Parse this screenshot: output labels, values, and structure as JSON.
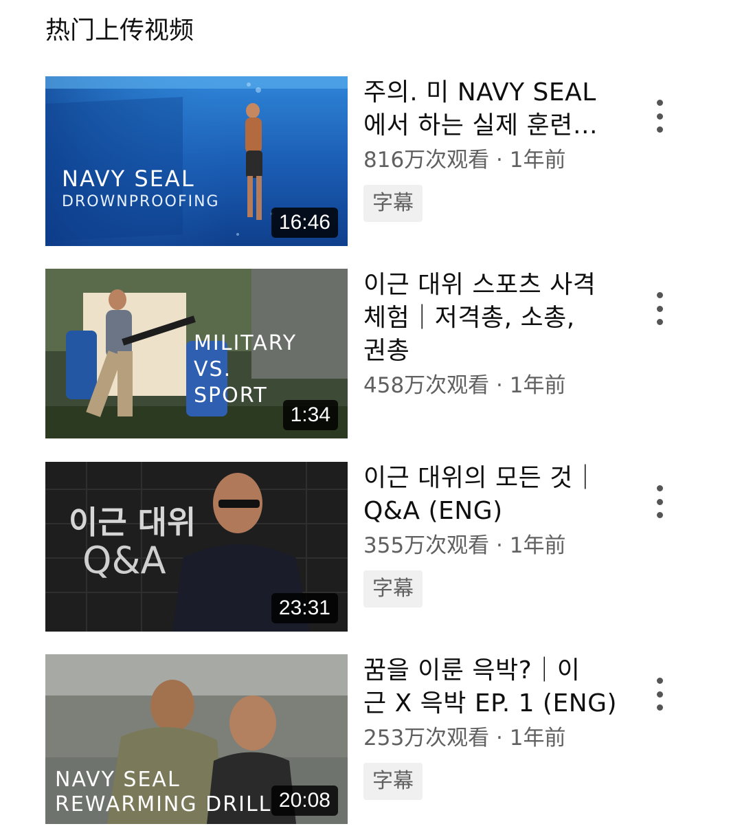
{
  "section": {
    "title": "热门上传视频"
  },
  "videos": [
    {
      "title_line1": "주의. 미 NAVY SEAL",
      "title_line2": "에서 하는 실제 훈련…",
      "title_line3": "",
      "stats": "816万次观看 · 1年前",
      "badge": "字幕",
      "duration": "16:46",
      "thumb_text": [
        "NAVY SEAL",
        "DROWNPROOFING"
      ]
    },
    {
      "title_line1": "이근 대위 스포츠 사격",
      "title_line2": "체험｜저격총, 소총,",
      "title_line3": "권총",
      "stats": "458万次观看 · 1年前",
      "badge": "",
      "duration": "1:34",
      "thumb_text": [
        "MILITARY",
        "VS.",
        "SPORT"
      ]
    },
    {
      "title_line1": "이근 대위의 모든 것｜",
      "title_line2": "Q&A (ENG)",
      "title_line3": "",
      "stats": "355万次观看 · 1年前",
      "badge": "字幕",
      "duration": "23:31",
      "thumb_text": [
        "이근 대위",
        "Q&A"
      ]
    },
    {
      "title_line1": "꿈을 이룬 윽박?｜이",
      "title_line2": "근 X 윽박 EP. 1 (ENG)",
      "title_line3": "",
      "stats": "253万次观看 · 1年前",
      "badge": "字幕",
      "duration": "20:08",
      "thumb_text": [
        "NAVY SEAL",
        "REWARMING DRILL"
      ]
    }
  ],
  "icons": {
    "more": "more-vert-icon"
  },
  "colors": {
    "text_primary": "#0f0f0f",
    "text_secondary": "#606060",
    "badge_bg": "#f0f0f0",
    "duration_bg": "#000000"
  }
}
